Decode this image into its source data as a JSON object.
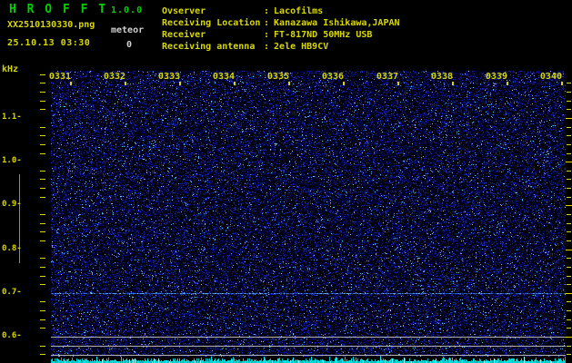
{
  "header": {
    "app_title": "H R O F F T",
    "version": "1.0.0",
    "filename": "XX2510130330.png",
    "meteor_label": "meteor",
    "meteor_count": "0",
    "datetime": "25.10.13 03:30",
    "colon": ":",
    "info_rows": [
      {
        "label": "Ovserver",
        "value": "Lacofilms"
      },
      {
        "label": "Receiving Location",
        "value": "Kanazawa Ishikawa,JAPAN"
      },
      {
        "label": "Receiver",
        "value": "FT-817ND 50MHz USB"
      },
      {
        "label": "Receiving antenna",
        "value": "2ele HB9CV"
      }
    ]
  },
  "axes": {
    "unit_label": "kHz",
    "freq_labels": [
      "1.1",
      "1.0",
      "0.9",
      "0.8",
      "0.7",
      "0.6"
    ],
    "freq_major_dash": "-",
    "time_labels": [
      "0331",
      "0332",
      "0333",
      "0334",
      "0335",
      "0336",
      "0337",
      "0338",
      "0339",
      "0340"
    ]
  },
  "spectrogram": {
    "type": "radio spectrogram (blue speckle noise field)",
    "freq_axis_range_khz": [
      0.56,
      1.21
    ],
    "time_start": "0331",
    "time_end": "0340",
    "carrier_line_khz": 0.72,
    "horizontal_gray_lines_near_khz": [
      0.6,
      0.58,
      0.56
    ],
    "bottom_strip": "cyan signal-level meter"
  },
  "colors": {
    "yellow": "#d8d800",
    "green": "#00d000",
    "white": "#d0d0d0",
    "cyan": "#00c8c8",
    "gray_line": "#b0b0b0",
    "vertical_gray_line": "#8a8a8a",
    "background": "#000000"
  }
}
